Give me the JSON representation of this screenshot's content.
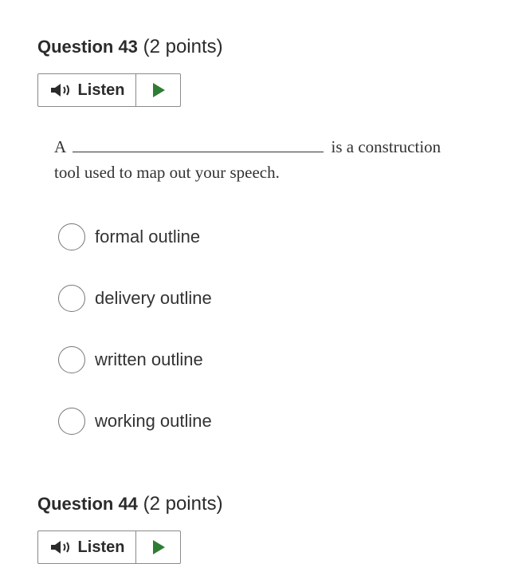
{
  "questions": [
    {
      "number_label": "Question 43",
      "points_label": "(2 points)",
      "listen_label": "Listen",
      "prompt_before": "A",
      "prompt_after": "is a construction tool used to map out your speech.",
      "options": [
        {
          "label": "formal outline"
        },
        {
          "label": "delivery outline"
        },
        {
          "label": "written outline"
        },
        {
          "label": "working outline"
        }
      ]
    },
    {
      "number_label": "Question 44",
      "points_label": "(2 points)",
      "listen_label": "Listen"
    }
  ],
  "icons": {
    "speaker": "speaker-icon",
    "play": "play-icon"
  },
  "colors": {
    "play_green": "#2e7d32",
    "border": "#8a8a8a"
  }
}
